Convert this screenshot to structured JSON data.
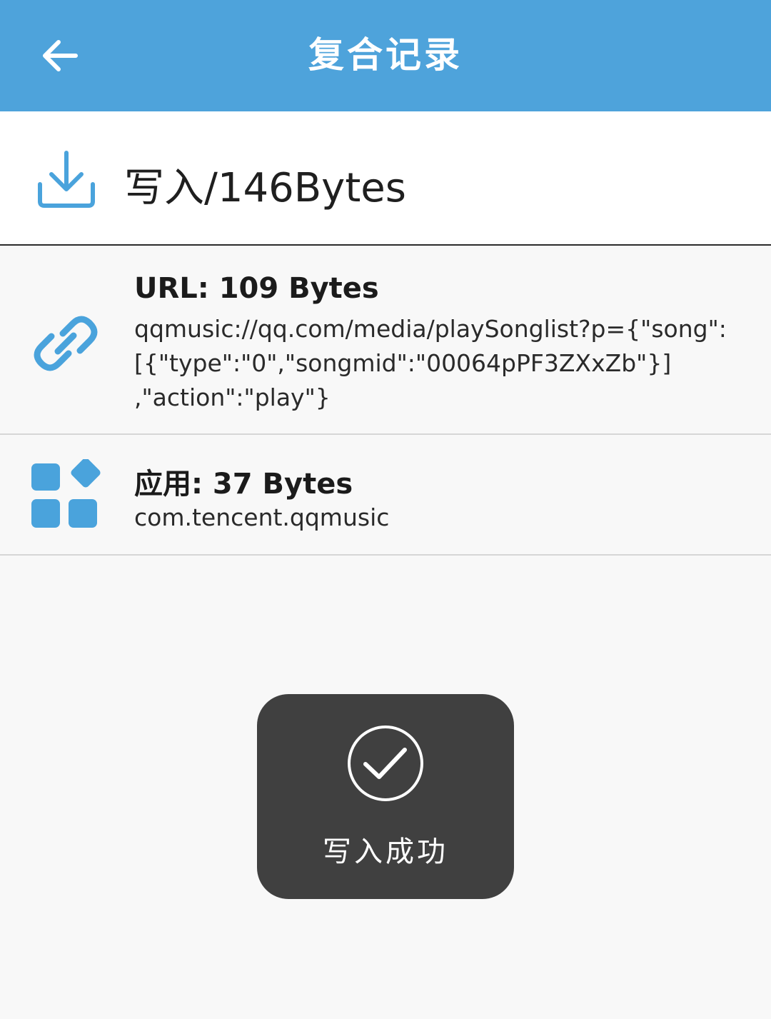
{
  "header": {
    "title": "复合记录",
    "back_icon": "arrow-left-icon",
    "background": "#4ea3db"
  },
  "summary": {
    "icon": "download-icon",
    "text": "写入/146Bytes",
    "accent": "#4aa3dc"
  },
  "records": [
    {
      "icon": "link-icon",
      "title": "URL: 109 Bytes",
      "lines": [
        "qqmusic://qq.com/media/playSonglist?p={\"song\":",
        "[{\"type\":\"0\",\"songmid\":\"00064pPF3ZXxZb\"}]",
        ",\"action\":\"play\"}"
      ]
    },
    {
      "icon": "apps-icon",
      "title": "应用: 37 Bytes",
      "lines": [
        "com.tencent.qqmusic"
      ]
    }
  ],
  "toast": {
    "icon": "check-circle-icon",
    "text": "写入成功",
    "background": "#404040"
  }
}
